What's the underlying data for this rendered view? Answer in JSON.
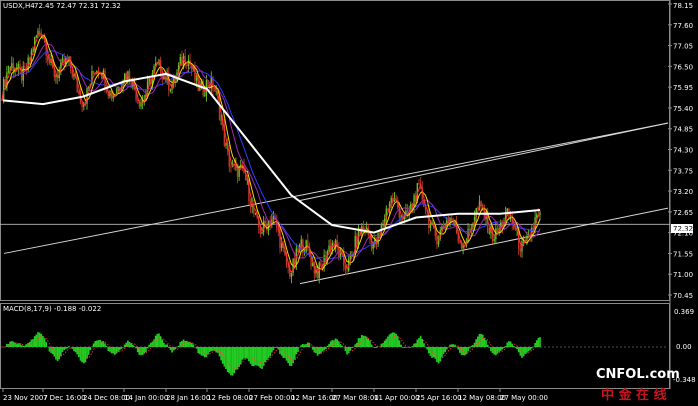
{
  "header": {
    "symbol_text": "USDX,H4",
    "ohlc_text": "72.45 72.47 72.31 72.32"
  },
  "indicator": {
    "macd_text": "MACD(8,17,9) -0.188 -0.022"
  },
  "price_axis": {
    "ticks": [
      "78.15",
      "77.60",
      "77.05",
      "76.50",
      "75.95",
      "75.40",
      "74.85",
      "74.30",
      "73.75",
      "73.20",
      "72.65",
      "72.10",
      "71.55",
      "71.00",
      "70.45"
    ],
    "current_price": "72.32"
  },
  "macd_axis": {
    "ticks": [
      "0.369",
      "0.00",
      "-0.348"
    ]
  },
  "time_axis": {
    "ticks": [
      "23 Nov 2007",
      "7 Dec 16:00",
      "24 Dec 08:00",
      "14 Jan 00:00",
      "28 Jan 16:00",
      "12 Feb 08:00",
      "27 Feb 00:00",
      "12 Mar 16:00",
      "27 Mar 08:00",
      "11 Apr 00:00",
      "25 Apr 16:00",
      "12 May 08:00",
      "27 May 00:00"
    ]
  },
  "watermark": {
    "latin": "CNFOL.com",
    "chinese": "中 金 在 线"
  },
  "colors": {
    "background": "#000000",
    "price_line": "#ffffff",
    "candle_up": "#6fbf2a",
    "candle_down": "#c0392b",
    "ma_fast": "#ff3030",
    "ma_mid": "#ffd400",
    "ma_slow": "#2f3cff",
    "ma_purple": "#9c2bb0",
    "histogram": "#22cc22",
    "signal": "#ff3b3b",
    "watermark_red": "#c8141e"
  },
  "chart_data": {
    "type": "line",
    "title": "",
    "xlabel": "",
    "ylabel": "",
    "ylim": [
      70.45,
      78.15
    ],
    "series": [
      {
        "name": "",
        "x": [
          "23 Nov 2007",
          "7 Dec 16:00",
          "24 Dec 08:00",
          "14 Jan 00:00",
          "28 Jan 16:00",
          "12 Feb 08:00",
          "27 Feb 00:00",
          "12 Mar 16:00",
          "27 Mar 08:00",
          "11 Apr 00:00",
          "25 Apr 16:00",
          "12 May 08:00",
          "27 May 00:00"
        ],
        "values": [
          75.6,
          77.3,
          75.9,
          75.9,
          76.5,
          75.9,
          73.2,
          71.1,
          71.7,
          71.9,
          73.1,
          72.0,
          72.3
        ]
      }
    ]
  }
}
